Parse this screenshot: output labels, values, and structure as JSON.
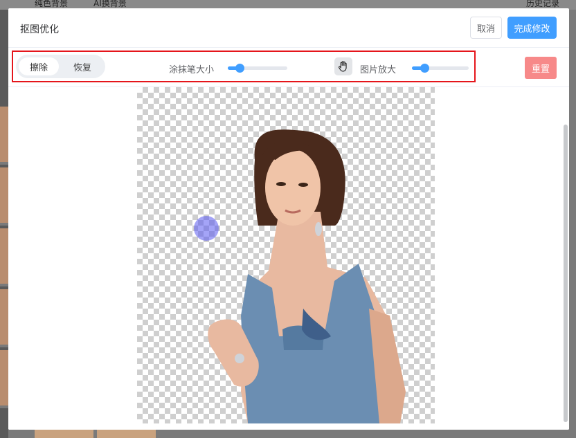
{
  "background": {
    "tabs": [
      "纯色背景",
      "AI换背景"
    ],
    "right_text": "历史记录"
  },
  "modal": {
    "title": "抠图优化",
    "cancel_label": "取消",
    "finish_label": "完成修改"
  },
  "toolbar": {
    "mode_erase": "擦除",
    "mode_restore": "恢复",
    "brush_size_label": "涂抹笔大小",
    "brush_size_value": 0.2,
    "zoom_label": "图片放大",
    "zoom_value": 0.22,
    "reset_label": "重置",
    "hand_icon": "hand-icon"
  },
  "colors": {
    "primary": "#409eff",
    "danger_light": "#f78989",
    "highlight": "#e5151b"
  }
}
